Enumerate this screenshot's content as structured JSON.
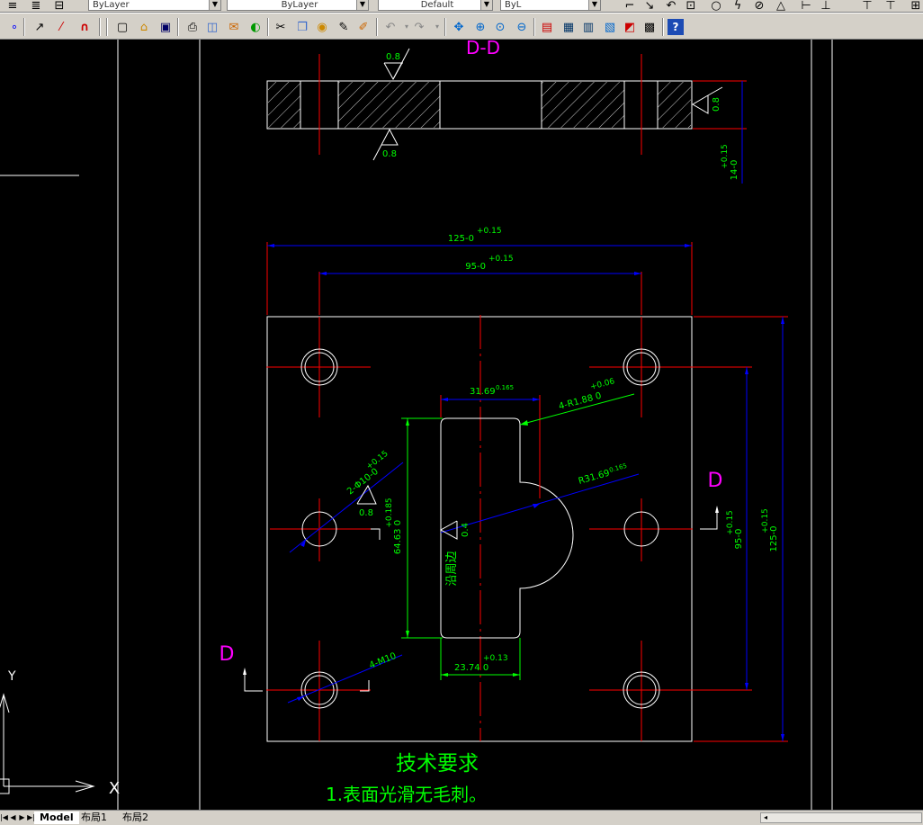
{
  "toolbar_top": {
    "layer_combo": "ByLayer",
    "linetype_combo": "ByLayer",
    "lineweight_combo": "Default",
    "plotstyle_combo": "ByL"
  },
  "toolbar_icons": [
    "zoom-icon",
    "polyline-icon",
    "trim-icon",
    "snap-icon",
    "new-icon",
    "open-icon",
    "save-icon",
    "print-icon",
    "preview-icon",
    "publish-icon",
    "3d-icon",
    "cut-icon",
    "copy-icon",
    "paste-icon",
    "brush-icon",
    "match-icon",
    "undo-icon",
    "redo-icon",
    "pan-icon",
    "zoom-realtime-icon",
    "zoom-window-icon",
    "zoom-previous-icon",
    "properties-icon",
    "designcenter-icon",
    "toolpalette-icon",
    "sheetset-icon",
    "markup-icon",
    "calculator-icon",
    "help-icon"
  ],
  "drawing": {
    "section_title": "D-D",
    "roughness_top": "0.8",
    "roughness_bottom": "0.8",
    "roughness_right": "0.8",
    "thickness_dim": "14",
    "thickness_tol_upper": "+0.15",
    "thickness_tol_lower": "-0",
    "width_125": "125",
    "width_125_upper": "+0.15",
    "width_125_lower": "-0",
    "width_95": "95",
    "width_95_upper": "+0.15",
    "width_95_lower": "-0",
    "slot_width": "31.69",
    "slot_width_tol": "0.165",
    "corner_radius": "4-R1.88",
    "corner_radius_upper": "+0.06",
    "corner_radius_lower": "0",
    "arc_radius": "R31.69",
    "arc_radius_tol": "0.165",
    "hole_dim": "2-Φ10",
    "hole_dim_upper": "+0.15",
    "hole_dim_lower": "-0",
    "roughness_hole": "0.8",
    "slot_height": "64.63",
    "slot_height_upper": "+0.185",
    "slot_height_lower": "0",
    "roughness_slot": "0.4",
    "along_edge": "沿周边",
    "thread_dim": "4-M10",
    "slot_bottom_width": "23.74",
    "slot_bottom_upper": "+0.13",
    "slot_bottom_lower": "0",
    "height_95": "95",
    "height_95_upper": "+0.15",
    "height_95_lower": "-0",
    "height_125": "125",
    "height_125_upper": "+0.15",
    "height_125_lower": "-0",
    "section_mark_right": "D",
    "section_mark_left": "D",
    "axis_y": "Y",
    "axis_x": "X",
    "tech_title": "技术要求",
    "tech_item_1": "1.表面光滑无毛刺。"
  },
  "tabs": {
    "model": "Model",
    "layout1": "布局1",
    "layout2": "布局2"
  },
  "colors": {
    "background": "#000000",
    "outline": "#ffffff",
    "center_lines": "#ff0000",
    "dim_blue": "#0000ff",
    "dim_green": "#00ff00",
    "section_mark": "#ff00ff"
  }
}
